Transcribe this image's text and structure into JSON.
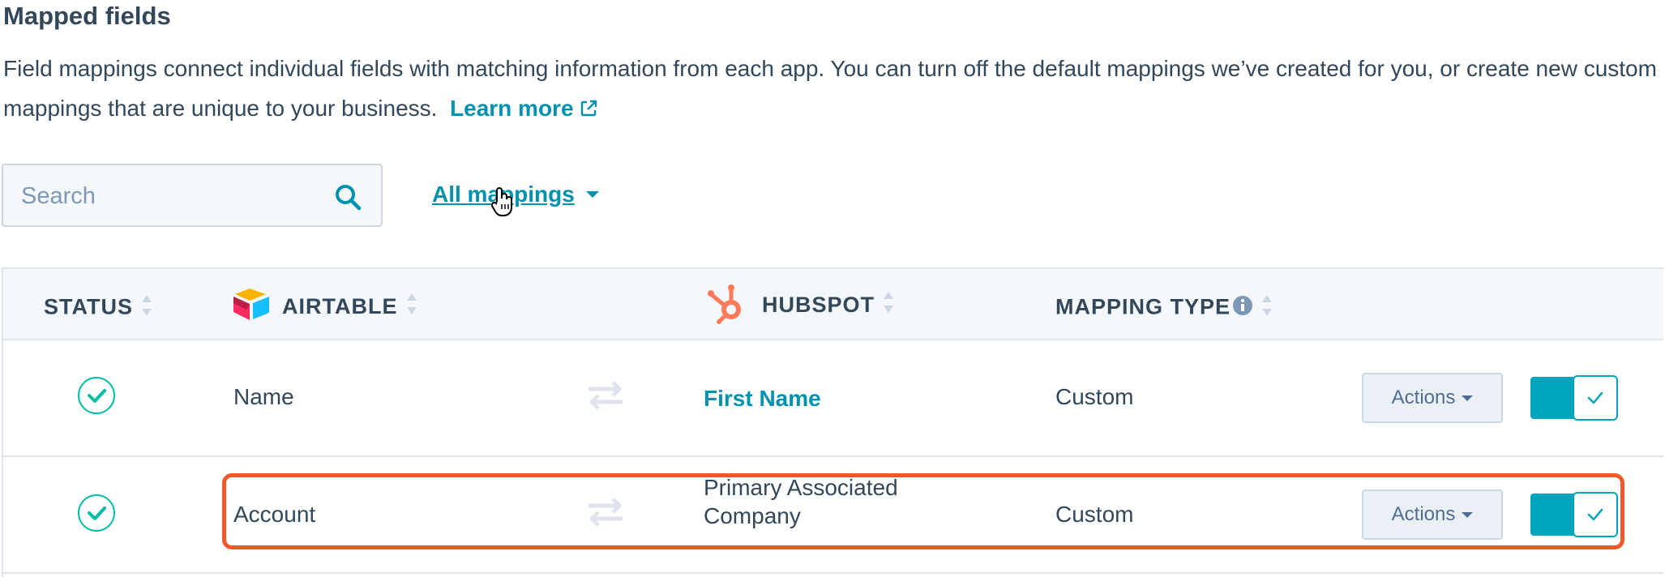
{
  "section": {
    "title": "Mapped fields",
    "description": "Field mappings connect individual fields with matching information from each app. You can turn off the default mappings we’ve created for you, or create new custom mappings that are unique to your business.",
    "learn_more": "Learn more"
  },
  "toolbar": {
    "search_placeholder": "Search",
    "filter_label": "All mappings"
  },
  "table": {
    "headers": {
      "status": "STATUS",
      "airtable": "AIRTABLE",
      "hubspot": "HUBSPOT",
      "mapping_type": "MAPPING TYPE"
    },
    "rows": [
      {
        "airtable": "Name",
        "hubspot": "First Name",
        "mapping_type": "Custom",
        "actions": "Actions",
        "status": "mapped",
        "enabled": true
      },
      {
        "airtable": "Account",
        "hubspot": "Primary Associated Company",
        "mapping_type": "Custom",
        "actions": "Actions",
        "status": "mapped",
        "enabled": true
      }
    ]
  },
  "colors": {
    "link": "#0091ae",
    "text": "#33475b",
    "toggle_on": "#00a4bd",
    "status_check": "#00bda5",
    "highlight": "#f05a2a",
    "hubspot_brand": "#ff7a59"
  }
}
